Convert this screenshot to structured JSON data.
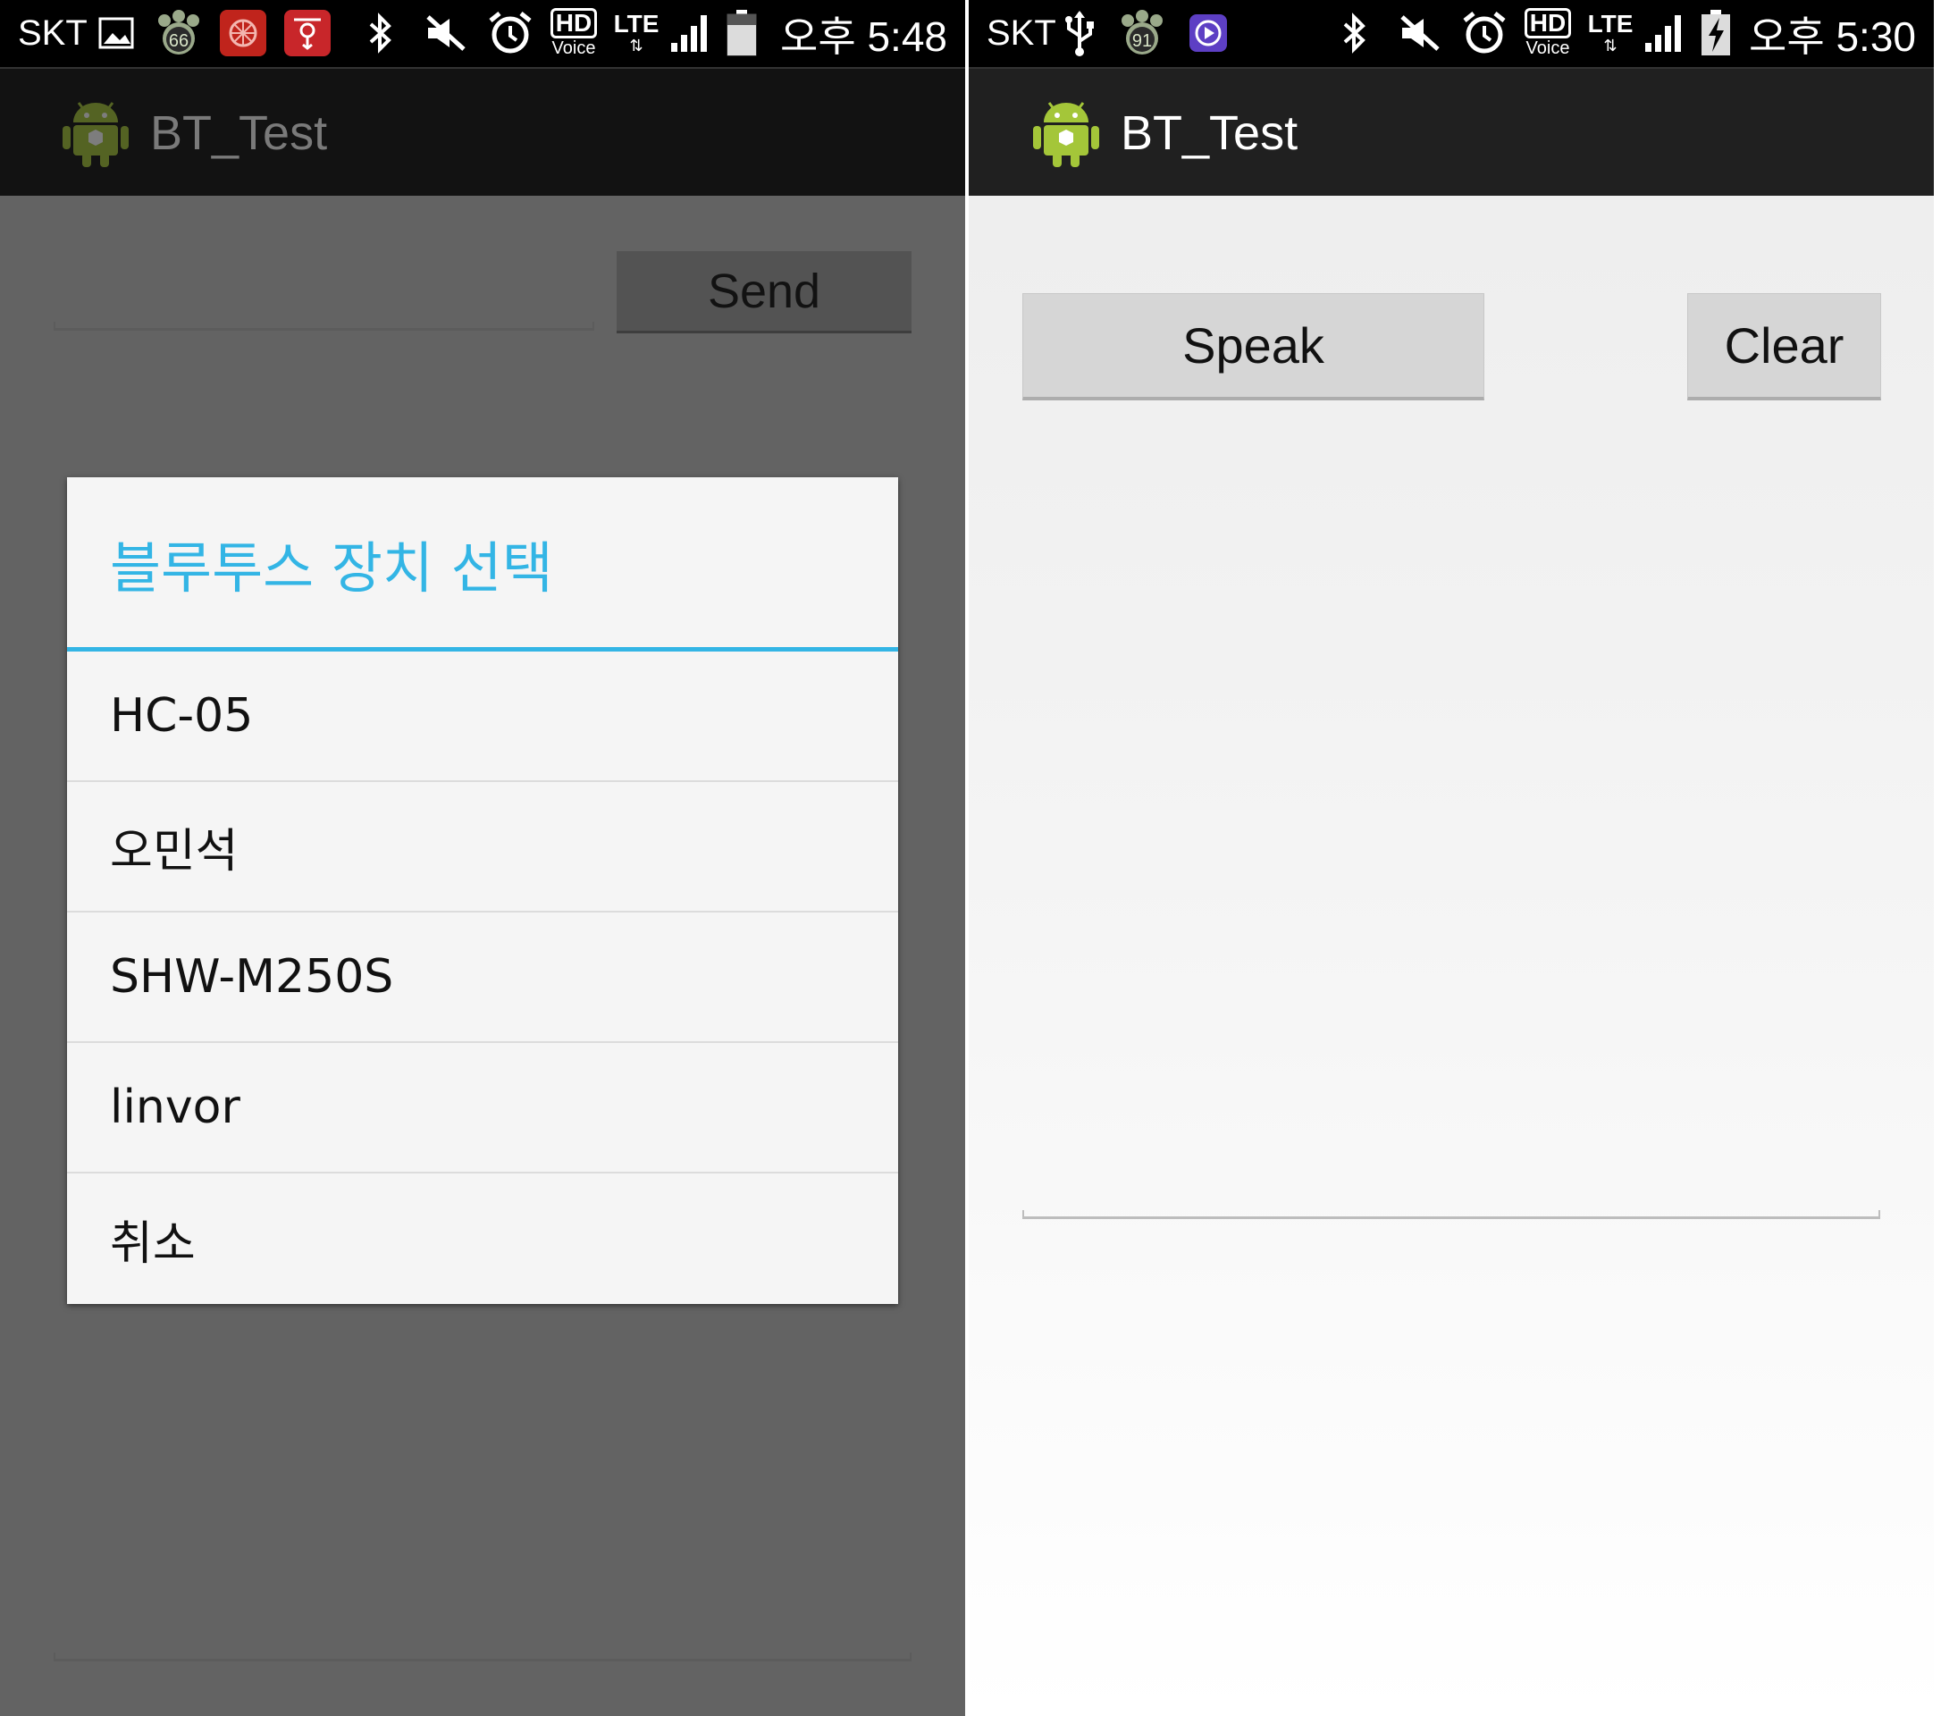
{
  "left": {
    "status": {
      "carrier": "SKT",
      "clock": "오후 5:48",
      "icons": [
        "gallery-icon",
        "paw-badge-66-icon",
        "red-app-icon",
        "red-bag-icon",
        "bluetooth-icon",
        "mute-icon",
        "alarm-icon",
        "hd-voice-icon",
        "lte-icon",
        "signal-icon",
        "battery-icon"
      ],
      "badge": "66",
      "hd": "HD",
      "voice": "Voice",
      "lte": "LTE"
    },
    "app_title": "BT_Test",
    "send_label": "Send",
    "dialog": {
      "title": "블루투스 장치 선택",
      "items": [
        "HC-05",
        "오민석",
        "SHW-M250S",
        "linvor",
        "취소"
      ]
    }
  },
  "right": {
    "status": {
      "carrier": "SKT",
      "clock": "오후 5:30",
      "icons": [
        "usb-icon",
        "paw-badge-91-icon",
        "purple-play-icon",
        "bluetooth-icon",
        "mute-icon",
        "alarm-icon",
        "hd-voice-icon",
        "lte-icon",
        "signal-icon",
        "battery-charging-icon"
      ],
      "badge": "91",
      "hd": "HD",
      "voice": "Voice",
      "lte": "LTE"
    },
    "app_title": "BT_Test",
    "speak_label": "Speak",
    "clear_label": "Clear"
  },
  "colors": {
    "accent": "#33b5e5",
    "dim_overlay": "#636363",
    "actionbar": "#202020"
  }
}
